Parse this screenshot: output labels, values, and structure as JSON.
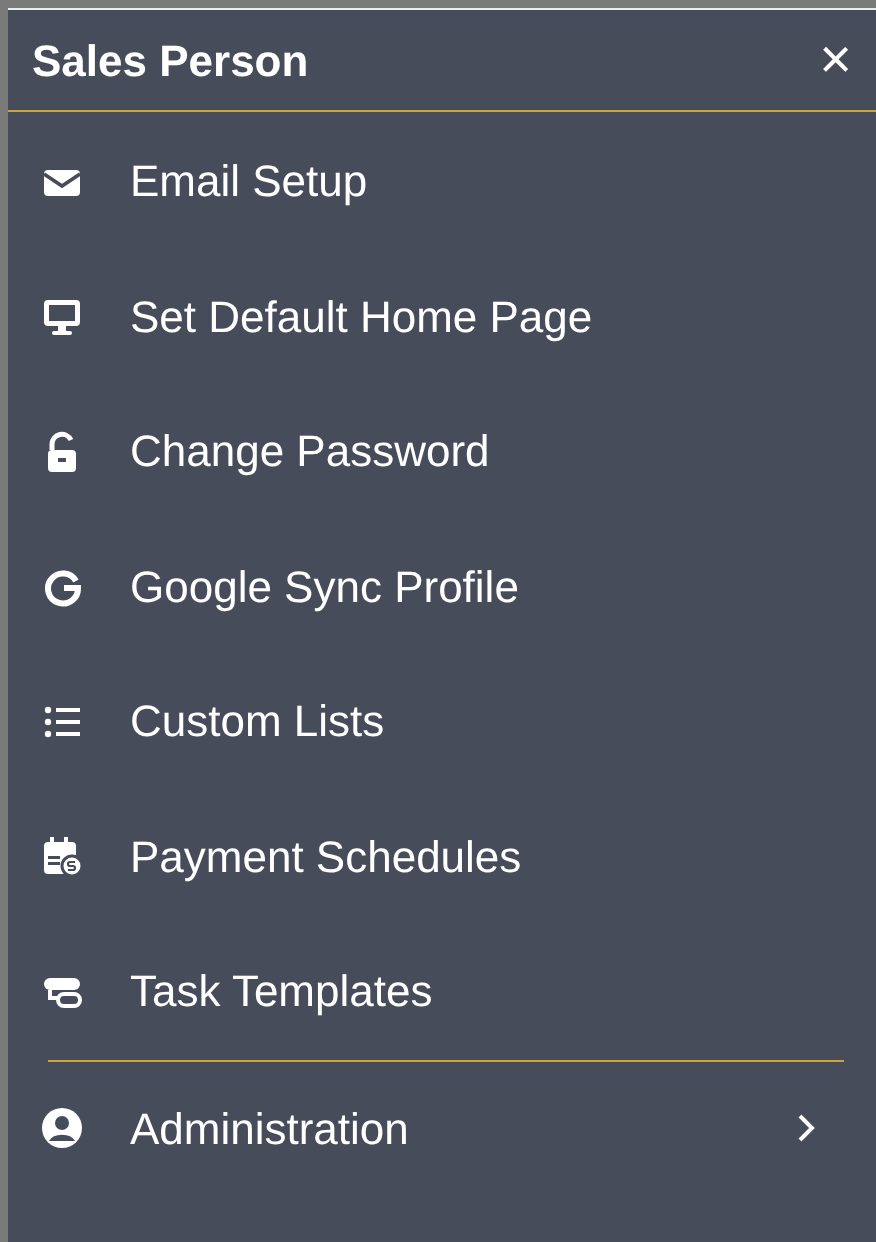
{
  "panel": {
    "title": "Sales Person",
    "close_label": "×"
  },
  "menu_groups": [
    {
      "items": [
        {
          "label": "Email Setup",
          "submenu": false
        },
        {
          "label": "Set Default Home Page",
          "submenu": false
        },
        {
          "label": "Change Password",
          "submenu": false
        },
        {
          "label": "Google Sync Profile",
          "submenu": false
        },
        {
          "label": "Custom Lists",
          "submenu": false
        },
        {
          "label": "Payment Schedules",
          "submenu": false
        },
        {
          "label": "Task Templates",
          "submenu": false
        }
      ]
    },
    {
      "items": [
        {
          "label": "Administration",
          "submenu": true
        }
      ]
    }
  ]
}
